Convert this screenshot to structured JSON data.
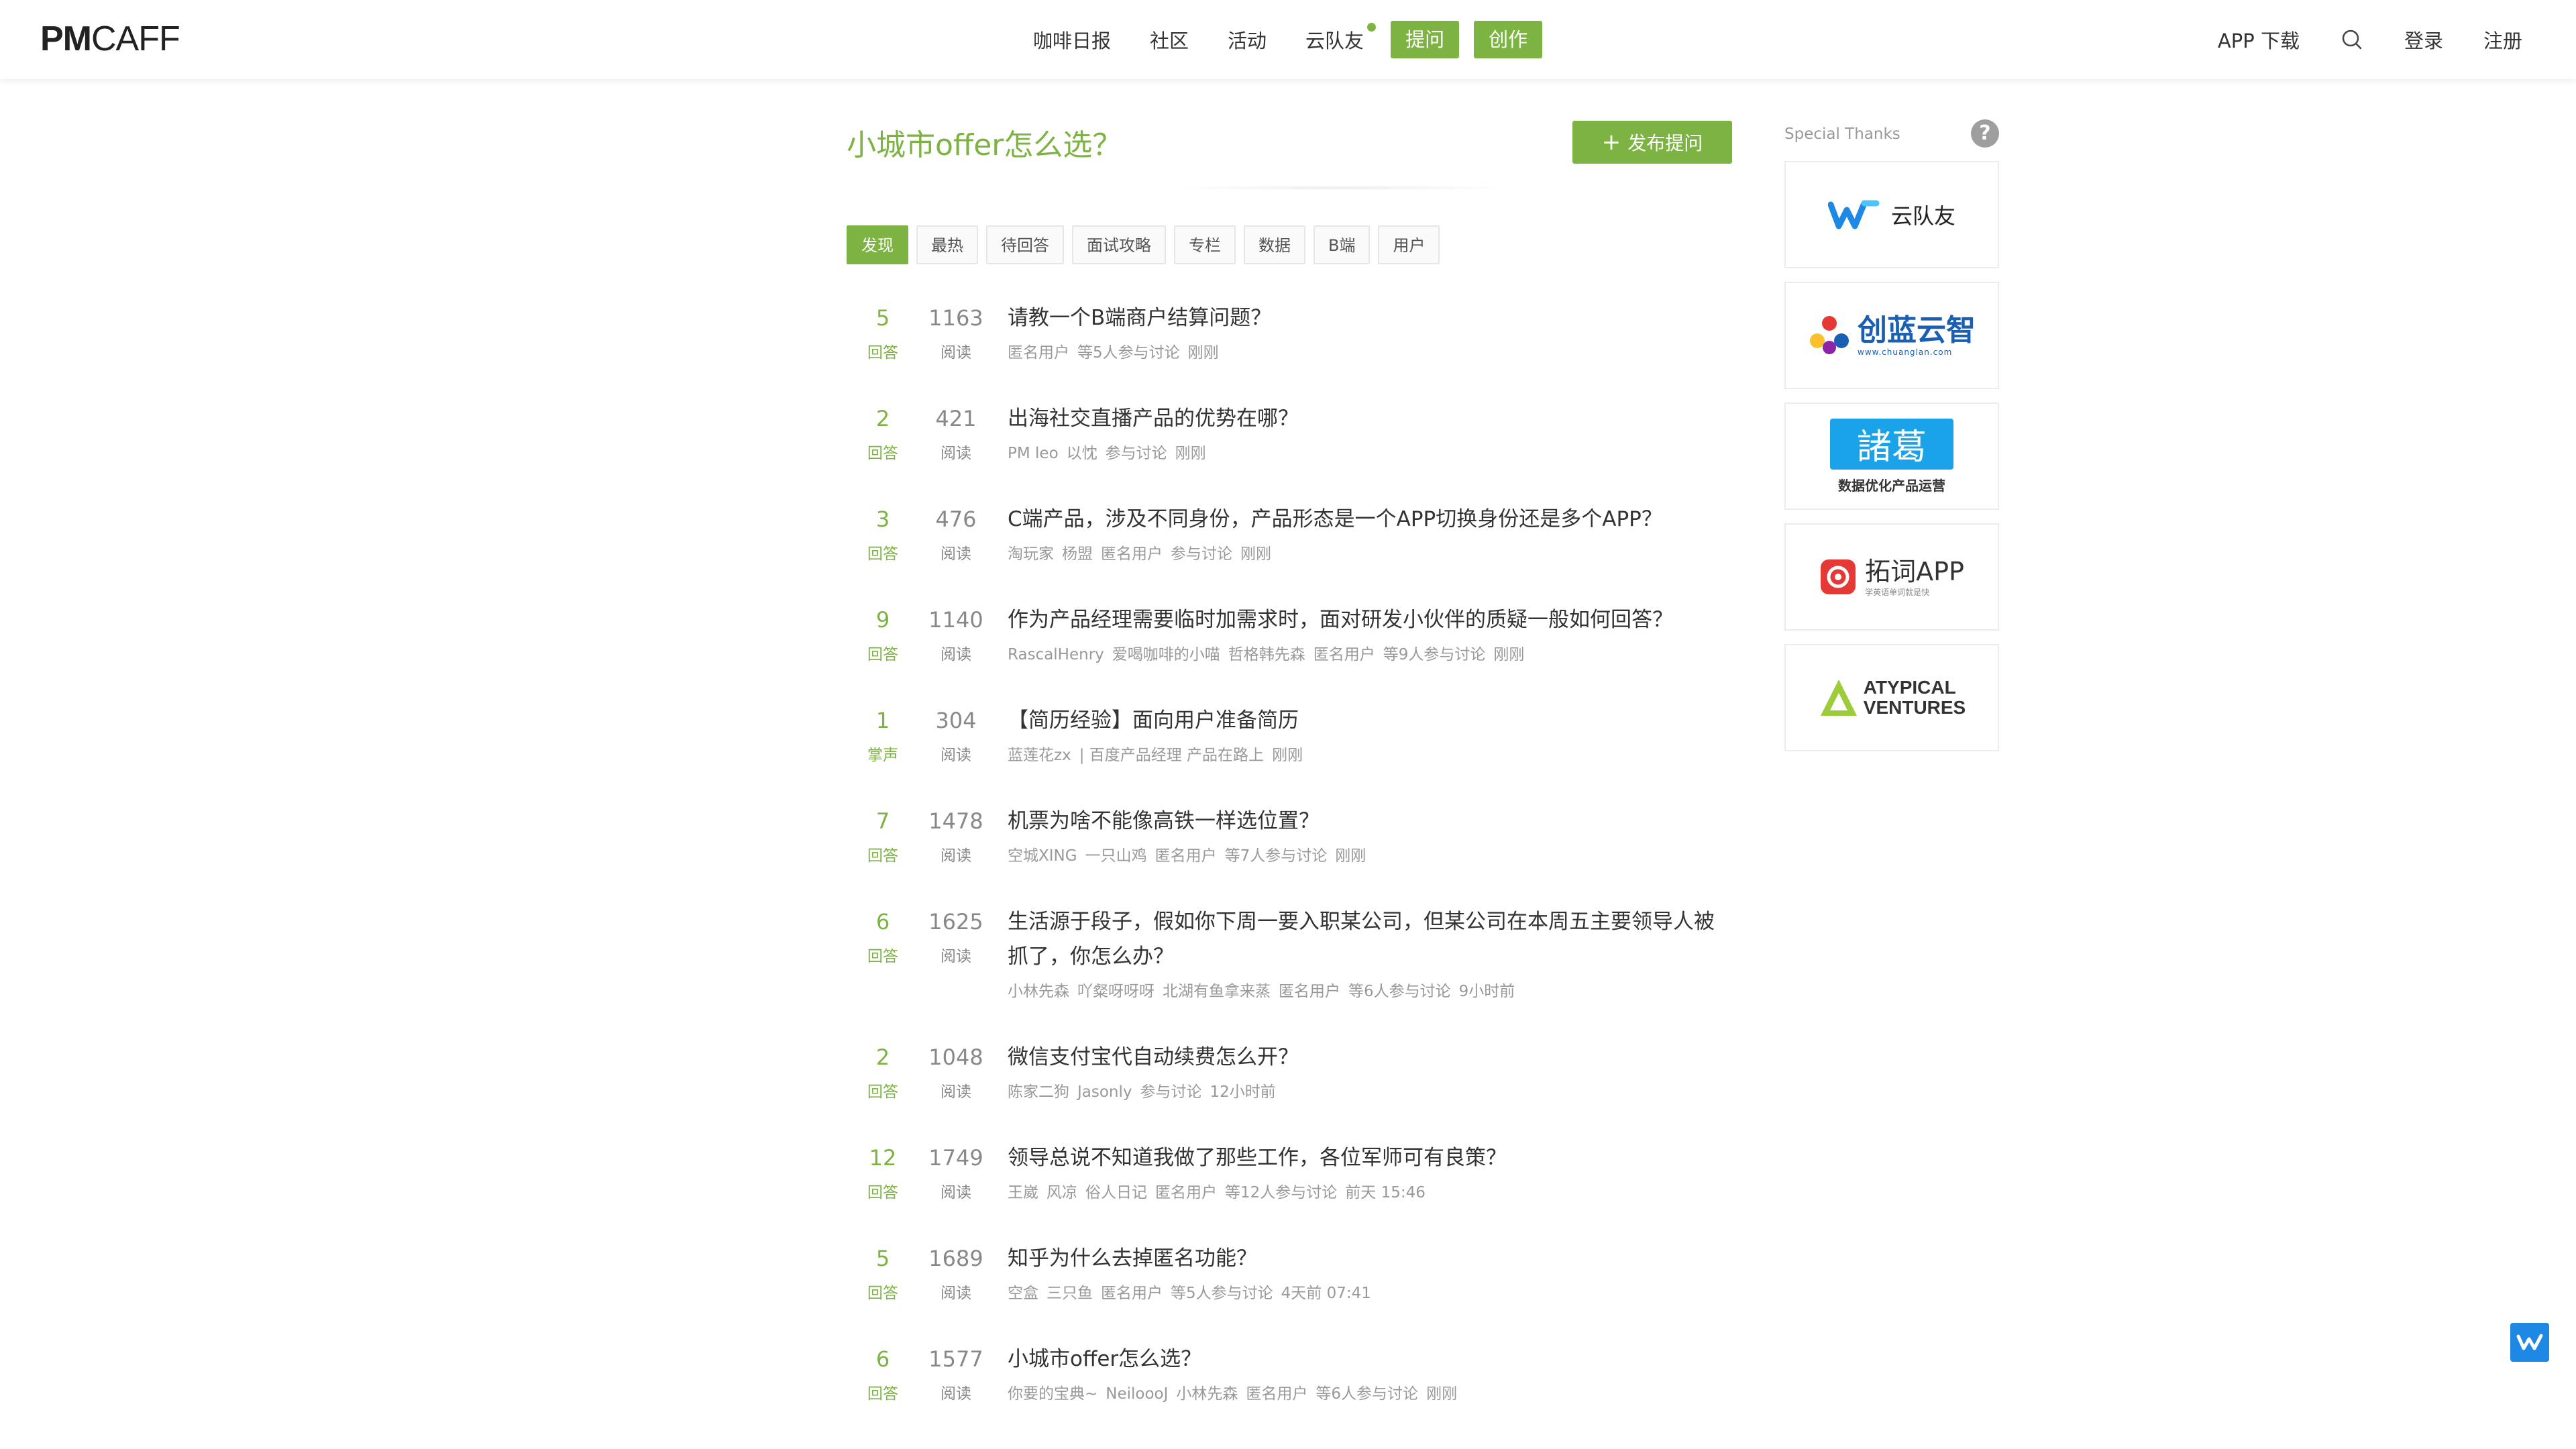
{
  "header": {
    "logo_pm": "PM",
    "logo_caff": "CAFF",
    "nav": [
      "咖啡日报",
      "社区",
      "活动",
      "云队友"
    ],
    "ask_btn": "提问",
    "create_btn": "创作",
    "app_download": "APP 下载",
    "login": "登录",
    "register": "注册"
  },
  "page": {
    "title": "小城市offer怎么选？",
    "publish_btn": "发布提问"
  },
  "tabs": [
    "发现",
    "最热",
    "待回答",
    "面试攻略",
    "专栏",
    "数据",
    "B端",
    "用户"
  ],
  "questions": [
    {
      "count": "5",
      "count_label": "回答",
      "reads": "1163",
      "read_label": "阅读",
      "title": "请教一个B端商户结算问题？",
      "meta": [
        "匿名用户",
        "等5人参与讨论",
        "刚刚"
      ]
    },
    {
      "count": "2",
      "count_label": "回答",
      "reads": "421",
      "read_label": "阅读",
      "title": "出海社交直播产品的优势在哪？",
      "meta": [
        "PM leo",
        "以忱",
        "参与讨论",
        "刚刚"
      ]
    },
    {
      "count": "3",
      "count_label": "回答",
      "reads": "476",
      "read_label": "阅读",
      "title": "C端产品，涉及不同身份，产品形态是一个APP切换身份还是多个APP？",
      "meta": [
        "淘玩家",
        "杨盟",
        "匿名用户",
        "参与讨论",
        "刚刚"
      ]
    },
    {
      "count": "9",
      "count_label": "回答",
      "reads": "1140",
      "read_label": "阅读",
      "title": "作为产品经理需要临时加需求时，面对研发小伙伴的质疑一般如何回答？",
      "meta": [
        "RascalHenry",
        "爱喝咖啡的小喵",
        "哲格韩先森",
        "匿名用户",
        "等9人参与讨论",
        "刚刚"
      ]
    },
    {
      "count": "1",
      "count_label": "掌声",
      "reads": "304",
      "read_label": "阅读",
      "title": "【简历经验】面向用户准备简历",
      "meta": [
        "蓝莲花zx",
        "| 百度产品经理 产品在路上",
        "刚刚"
      ]
    },
    {
      "count": "7",
      "count_label": "回答",
      "reads": "1478",
      "read_label": "阅读",
      "title": "机票为啥不能像高铁一样选位置？",
      "meta": [
        "空城XING",
        "一只山鸡",
        "匿名用户",
        "等7人参与讨论",
        "刚刚"
      ]
    },
    {
      "count": "6",
      "count_label": "回答",
      "reads": "1625",
      "read_label": "阅读",
      "title": "生活源于段子，假如你下周一要入职某公司，但某公司在本周五主要领导人被抓了，你怎么办？",
      "meta": [
        "小林先森",
        "吖粲呀呀呀",
        "北湖有鱼拿来蒸",
        "匿名用户",
        "等6人参与讨论",
        "9小时前"
      ]
    },
    {
      "count": "2",
      "count_label": "回答",
      "reads": "1048",
      "read_label": "阅读",
      "title": "微信支付宝代自动续费怎么开？",
      "meta": [
        "陈家二狗",
        "Jasonly",
        "参与讨论",
        "12小时前"
      ]
    },
    {
      "count": "12",
      "count_label": "回答",
      "reads": "1749",
      "read_label": "阅读",
      "title": "领导总说不知道我做了那些工作，各位军师可有良策？",
      "meta": [
        "王崴",
        "风凉",
        "俗人日记",
        "匿名用户",
        "等12人参与讨论",
        "前天 15:46"
      ]
    },
    {
      "count": "5",
      "count_label": "回答",
      "reads": "1689",
      "read_label": "阅读",
      "title": "知乎为什么去掉匿名功能？",
      "meta": [
        "空盒",
        "三只鱼",
        "匿名用户",
        "等5人参与讨论",
        "4天前 07:41"
      ]
    },
    {
      "count": "6",
      "count_label": "回答",
      "reads": "1577",
      "read_label": "阅读",
      "title": "小城市offer怎么选？",
      "meta": [
        "你要的宝典~",
        "NeiloooJ",
        "小林先森",
        "匿名用户",
        "等6人参与讨论",
        "刚刚"
      ]
    }
  ],
  "sidebar": {
    "title": "Special Thanks",
    "help": "?",
    "sponsors": [
      {
        "name": "云队友",
        "icon": "yunduiyou-logo-icon",
        "color": "#1e88e5"
      },
      {
        "name": "创蓝云智",
        "sub": "www.chuanglan.com",
        "icon": "chuanglan-logo-icon",
        "color": "#1a5fb4"
      },
      {
        "name": "諸葛",
        "sub": "数据优化产品运营",
        "icon": "zhuge-logo-icon",
        "color": "#1aa3e8"
      },
      {
        "name": "拓词APP",
        "sub": "学英语单词就是快",
        "icon": "tuoci-logo-icon",
        "color": "#e53935"
      },
      {
        "name": "ATYPICAL",
        "name2": "VENTURES",
        "icon": "atypical-logo-icon",
        "color": "#9ccc3a"
      }
    ]
  },
  "colors": {
    "accent": "#7cb342",
    "float": "#1e88e5"
  }
}
